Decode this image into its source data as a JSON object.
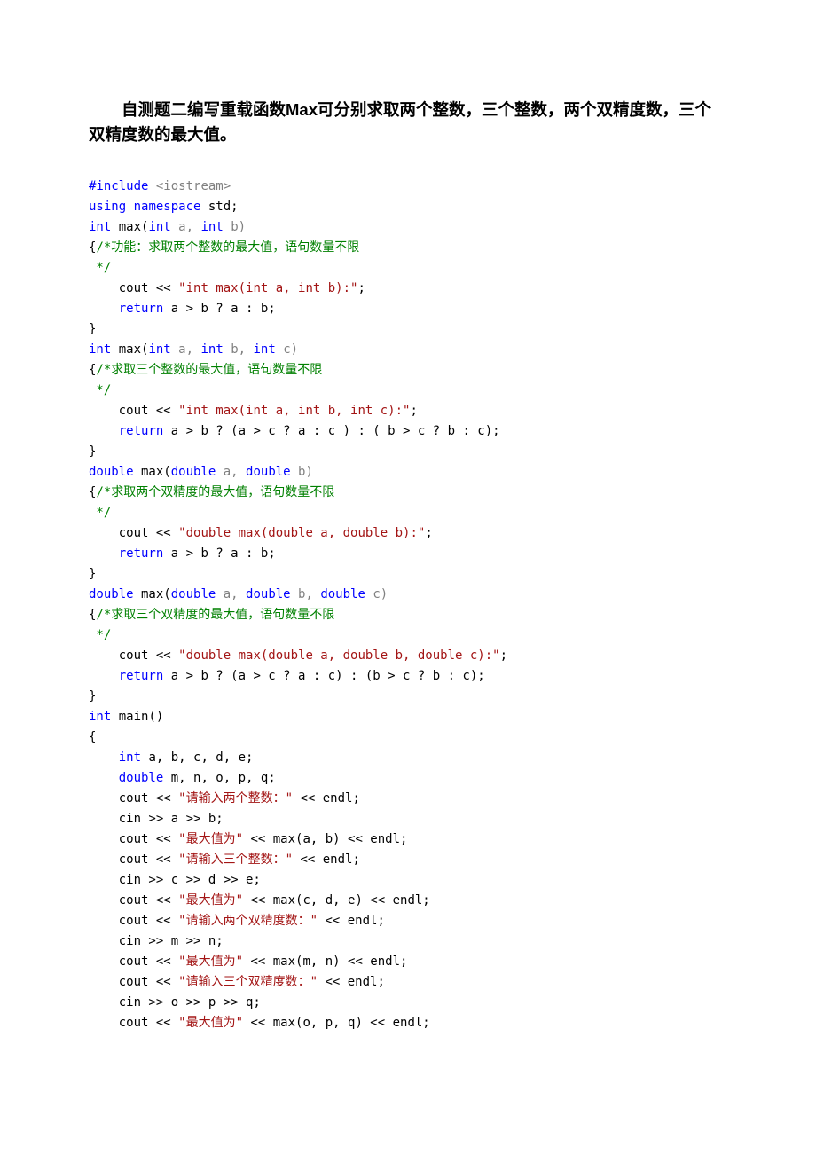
{
  "title": "自测题二编写重载函数Max可分别求取两个整数，三个整数，两个双精度数，三个双精度数的最大值。",
  "code": {
    "l1a": "#include",
    "l1b": " <iostream>",
    "l2a": "using",
    "l2b": " namespace",
    "l2c": " std;",
    "l3a": "int",
    "l3b": " max(",
    "l3c": "int",
    "l3d": " a, ",
    "l3e": "int",
    "l3f": " b)",
    "l4a": "{",
    "l4b": "/*功能：求取两个整数的最大值，语句数量不限",
    "l5": " */",
    "l6a": "    cout << ",
    "l6b": "\"int max(int a, int b):\"",
    "l6c": ";",
    "l7a": "    ",
    "l7b": "return",
    "l7c": " a > b ? a : b;",
    "l8": "}",
    "l9a": "int",
    "l9b": " max(",
    "l9c": "int",
    "l9d": " a, ",
    "l9e": "int",
    "l9f": " b, ",
    "l9g": "int",
    "l9h": " c)",
    "l10a": "{",
    "l10b": "/*求取三个整数的最大值，语句数量不限",
    "l11": " */",
    "l12a": "    cout << ",
    "l12b": "\"int max(int a, int b, int c):\"",
    "l12c": ";",
    "l13a": "    ",
    "l13b": "return",
    "l13c": " a > b ? (a > c ? a : c ) : ( b > c ? b : c);",
    "l14": "}",
    "l15a": "double",
    "l15b": " max(",
    "l15c": "double",
    "l15d": " a, ",
    "l15e": "double",
    "l15f": " b)",
    "l16a": "{",
    "l16b": "/*求取两个双精度的最大值，语句数量不限",
    "l17": " */",
    "l18a": "    cout << ",
    "l18b": "\"double max(double a, double b):\"",
    "l18c": ";",
    "l19a": "    ",
    "l19b": "return",
    "l19c": " a > b ? a : b;",
    "l20": "}",
    "l21a": "double",
    "l21b": " max(",
    "l21c": "double",
    "l21d": " a, ",
    "l21e": "double",
    "l21f": " b, ",
    "l21g": "double",
    "l21h": " c)",
    "l22a": "{",
    "l22b": "/*求取三个双精度的最大值，语句数量不限",
    "l23": " */",
    "l24a": "    cout << ",
    "l24b": "\"double max(double a, double b, double c):\"",
    "l24c": ";",
    "l25a": "    ",
    "l25b": "return",
    "l25c": " a > b ? (a > c ? a : c) : (b > c ? b : c);",
    "l26": "}",
    "l27a": "int",
    "l27b": " main()",
    "l28": "{",
    "l29a": "    ",
    "l29b": "int",
    "l29c": " a, b, c, d, e;",
    "l30a": "    ",
    "l30b": "double",
    "l30c": " m, n, o, p, q;",
    "l31a": "    cout << ",
    "l31b": "\"请输入两个整数：\"",
    "l31c": " << endl;",
    "l32": "    cin >> a >> b;",
    "l33a": "    cout << ",
    "l33b": "\"最大值为\"",
    "l33c": " << max(a, b) << endl;",
    "l34a": "    cout << ",
    "l34b": "\"请输入三个整数：\"",
    "l34c": " << endl;",
    "l35": "    cin >> c >> d >> e;",
    "l36a": "    cout << ",
    "l36b": "\"最大值为\"",
    "l36c": " << max(c, d, e) << endl;",
    "l37a": "    cout << ",
    "l37b": "\"请输入两个双精度数：\"",
    "l37c": " << endl;",
    "l38": "    cin >> m >> n;",
    "l39a": "    cout << ",
    "l39b": "\"最大值为\"",
    "l39c": " << max(m, n) << endl;",
    "l40a": "    cout << ",
    "l40b": "\"请输入三个双精度数：\"",
    "l40c": " << endl;",
    "l41": "    cin >> o >> p >> q;",
    "l42a": "    cout << ",
    "l42b": "\"最大值为\"",
    "l42c": " << max(o, p, q) << endl;"
  }
}
